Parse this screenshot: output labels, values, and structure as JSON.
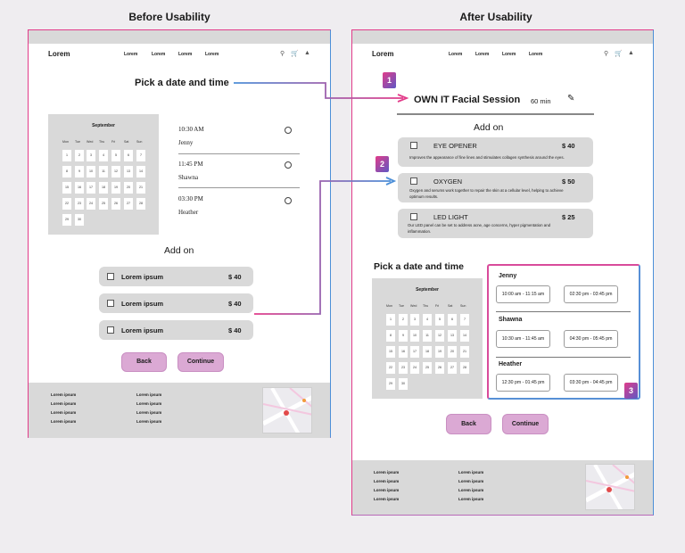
{
  "headings": {
    "before": "Before Usability",
    "after": "After Usability"
  },
  "nav": {
    "logo": "Lorem",
    "links": [
      "Lorem",
      "Lorem",
      "Lorem",
      "Lorem"
    ]
  },
  "calendar": {
    "month": "September",
    "weekdays": [
      "Mon",
      "Tue",
      "Wed",
      "Thu",
      "Fri",
      "Sat",
      "Sun"
    ],
    "days": [
      "1",
      "2",
      "3",
      "4",
      "5",
      "6",
      "7",
      "8",
      "9",
      "10",
      "11",
      "12",
      "13",
      "14",
      "15",
      "16",
      "17",
      "18",
      "19",
      "20",
      "21",
      "22",
      "23",
      "24",
      "25",
      "26",
      "27",
      "28",
      "29",
      "30"
    ]
  },
  "before": {
    "pick_title": "Pick a date and time",
    "slots": [
      {
        "time": "10:30 AM",
        "name": "Jenny"
      },
      {
        "time": "11:45 PM",
        "name": "Shawna"
      },
      {
        "time": "03:30 PM",
        "name": "Heather"
      }
    ],
    "addon_title": "Add on",
    "addons": [
      {
        "label": "Lorem ipsum",
        "price": "$ 40"
      },
      {
        "label": "Lorem ipsum",
        "price": "$ 40"
      },
      {
        "label": "Lorem ipsum",
        "price": "$ 40"
      }
    ],
    "back": "Back",
    "continue": "Continue",
    "footer": [
      "Lorem ipsum",
      "Lorem ipsum",
      "Lorem ipsum",
      "Lorem ipsum",
      "Lorem ipsum",
      "Lorem ipsum",
      "Lorem ipsum",
      "Lorem ipsum"
    ]
  },
  "after": {
    "session_title": "OWN IT Facial Session",
    "duration": "60 min",
    "addon_title": "Add on",
    "addons": [
      {
        "label": "EYE OPENER",
        "price": "$ 40",
        "desc": "Improves the appearance of fine lines and stimulates collagen synthesis around the eyes."
      },
      {
        "label": "OXYGEN",
        "price": "$ 50",
        "desc": "Oxygen and serums work together to repair the skin at a cellular level, helping to achieve optimum results."
      },
      {
        "label": "LED LIGHT",
        "price": "$ 25",
        "desc": "Our LED panel can be set to address acne, age concerns, hyper pigmentation and inflammation."
      }
    ],
    "pick_title": "Pick a date and time",
    "staff": [
      {
        "name": "Jenny",
        "times": [
          "10:00 am - 11:15 am",
          "02:30 pm - 03:45 pm"
        ]
      },
      {
        "name": "Shawna",
        "times": [
          "10:30 am - 11:45 am",
          "04:30 pm - 05:45 pm"
        ]
      },
      {
        "name": "Heather",
        "times": [
          "12:30 pm - 01:45 pm",
          "03:30 pm - 04:45 pm"
        ]
      }
    ],
    "back": "Back",
    "continue": "Continue",
    "footer": [
      "Lorem ipsum",
      "Lorem ipsum",
      "Lorem ipsum",
      "Lorem ipsum",
      "Lorem ipsum",
      "Lorem ipsum",
      "Lorem ipsum",
      "Lorem ipsum"
    ]
  },
  "badges": [
    "1",
    "2",
    "3"
  ],
  "colors": {
    "accent_pink": "#e23c8a",
    "accent_blue": "#4c8fd8",
    "button": "#dba9d4"
  }
}
